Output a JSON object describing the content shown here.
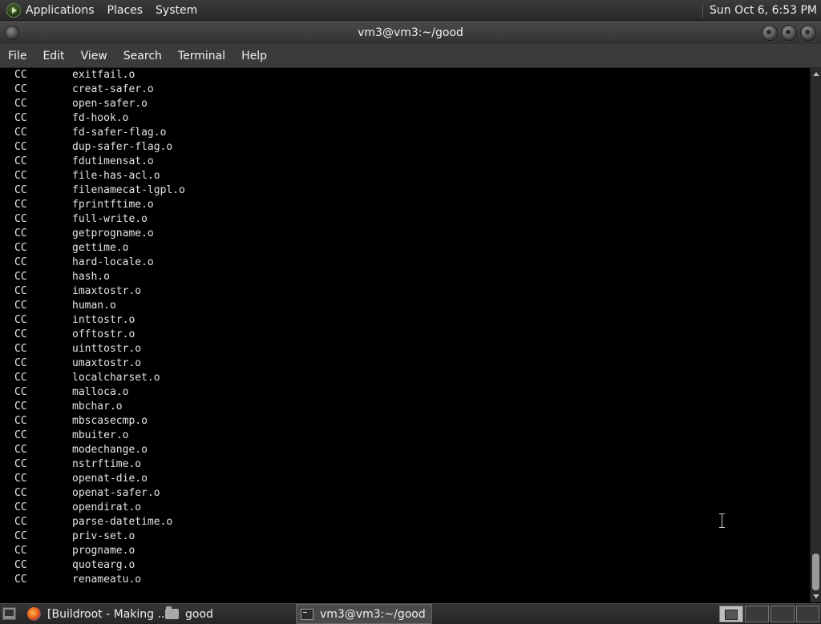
{
  "top_panel": {
    "menus": [
      "Applications",
      "Places",
      "System"
    ],
    "clock": "Sun Oct  6,  6:53 PM"
  },
  "window": {
    "title": "vm3@vm3:~/good"
  },
  "menubar": {
    "items": [
      "File",
      "Edit",
      "View",
      "Search",
      "Terminal",
      "Help"
    ]
  },
  "terminal": {
    "lines": [
      {
        "cmd": "CC",
        "file": "exitfail.o"
      },
      {
        "cmd": "CC",
        "file": "creat-safer.o"
      },
      {
        "cmd": "CC",
        "file": "open-safer.o"
      },
      {
        "cmd": "CC",
        "file": "fd-hook.o"
      },
      {
        "cmd": "CC",
        "file": "fd-safer-flag.o"
      },
      {
        "cmd": "CC",
        "file": "dup-safer-flag.o"
      },
      {
        "cmd": "CC",
        "file": "fdutimensat.o"
      },
      {
        "cmd": "CC",
        "file": "file-has-acl.o"
      },
      {
        "cmd": "CC",
        "file": "filenamecat-lgpl.o"
      },
      {
        "cmd": "CC",
        "file": "fprintftime.o"
      },
      {
        "cmd": "CC",
        "file": "full-write.o"
      },
      {
        "cmd": "CC",
        "file": "getprogname.o"
      },
      {
        "cmd": "CC",
        "file": "gettime.o"
      },
      {
        "cmd": "CC",
        "file": "hard-locale.o"
      },
      {
        "cmd": "CC",
        "file": "hash.o"
      },
      {
        "cmd": "CC",
        "file": "imaxtostr.o"
      },
      {
        "cmd": "CC",
        "file": "human.o"
      },
      {
        "cmd": "CC",
        "file": "inttostr.o"
      },
      {
        "cmd": "CC",
        "file": "offtostr.o"
      },
      {
        "cmd": "CC",
        "file": "uinttostr.o"
      },
      {
        "cmd": "CC",
        "file": "umaxtostr.o"
      },
      {
        "cmd": "CC",
        "file": "localcharset.o"
      },
      {
        "cmd": "CC",
        "file": "malloca.o"
      },
      {
        "cmd": "CC",
        "file": "mbchar.o"
      },
      {
        "cmd": "CC",
        "file": "mbscasecmp.o"
      },
      {
        "cmd": "CC",
        "file": "mbuiter.o"
      },
      {
        "cmd": "CC",
        "file": "modechange.o"
      },
      {
        "cmd": "CC",
        "file": "nstrftime.o"
      },
      {
        "cmd": "CC",
        "file": "openat-die.o"
      },
      {
        "cmd": "CC",
        "file": "openat-safer.o"
      },
      {
        "cmd": "CC",
        "file": "opendirat.o"
      },
      {
        "cmd": "CC",
        "file": "parse-datetime.o"
      },
      {
        "cmd": "CC",
        "file": "priv-set.o"
      },
      {
        "cmd": "CC",
        "file": "progname.o"
      },
      {
        "cmd": "CC",
        "file": "quotearg.o"
      },
      {
        "cmd": "CC",
        "file": "renameatu.o"
      }
    ]
  },
  "taskbar": {
    "tasks": [
      {
        "label": "[Buildroot - Making ...",
        "icon": "firefox-icon"
      },
      {
        "label": "good",
        "icon": "folder-icon"
      },
      {
        "label": "vm3@vm3:~/good",
        "icon": "terminal-icon",
        "active": true
      }
    ]
  }
}
